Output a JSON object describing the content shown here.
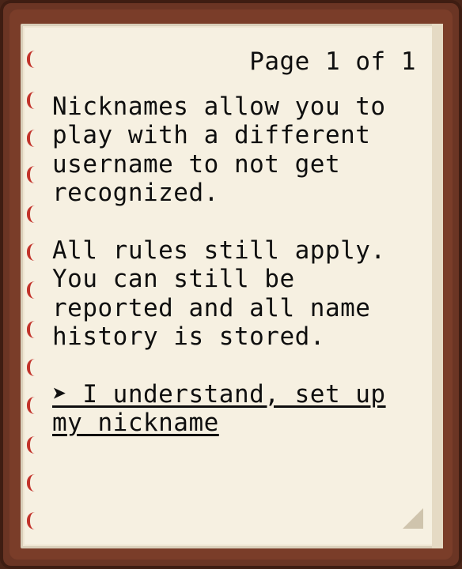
{
  "book": {
    "page_indicator": "Page 1 of 1",
    "paragraph_1": "Nicknames allow you to play with a different username to not get recognized.",
    "paragraph_2": "All rules still apply. You can still be reported and all name history is stored.",
    "action_link": "➤ I understand, set up my nickname"
  },
  "colors": {
    "cover": "#6b3524",
    "paper": "#f6f0e1",
    "ring": "#c2332b",
    "text": "#0f0f0f"
  }
}
